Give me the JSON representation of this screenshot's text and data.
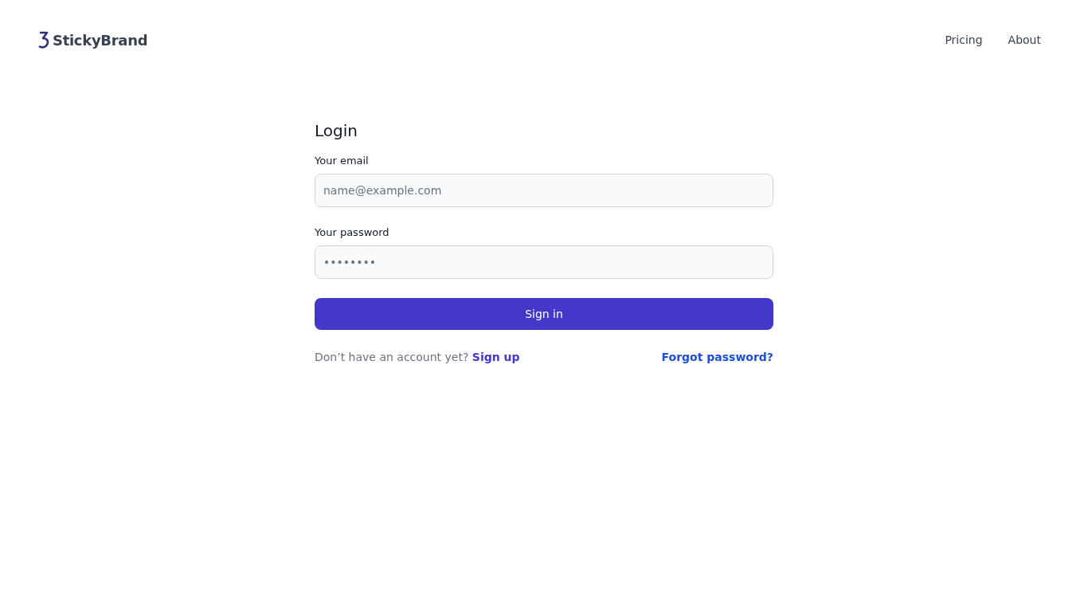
{
  "header": {
    "brand": "StickyBrand",
    "nav": [
      "Pricing",
      "About"
    ]
  },
  "login": {
    "title": "Login",
    "fields": [
      {
        "label": "Your email",
        "placeholder": "name@example.com"
      },
      {
        "label": "Your password",
        "placeholder": "••••••••"
      }
    ],
    "submit": "Sign in",
    "signup_prompt": "Don’t have an account yet?",
    "signup_link": "Sign up",
    "forgot_link": "Forgot password?"
  }
}
